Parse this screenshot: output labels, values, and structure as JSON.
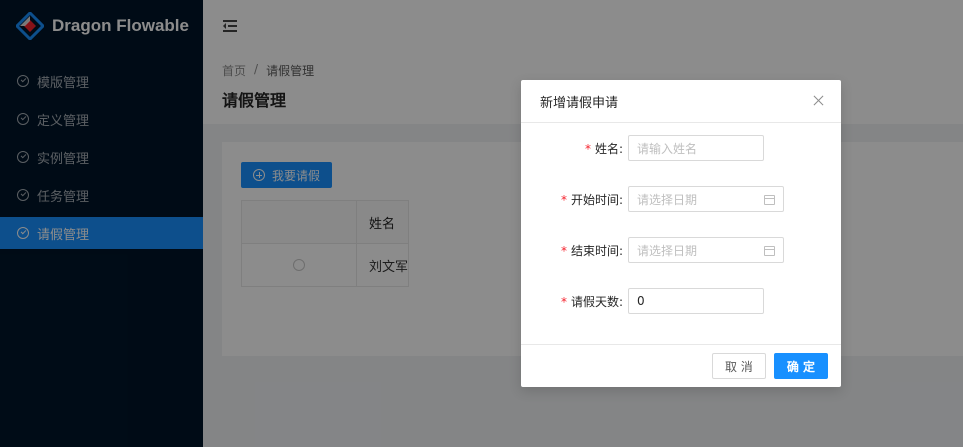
{
  "app": {
    "title": "Dragon Flowable"
  },
  "sidebar": {
    "items": [
      {
        "label": "模版管理"
      },
      {
        "label": "定义管理"
      },
      {
        "label": "实例管理"
      },
      {
        "label": "任务管理"
      },
      {
        "label": "请假管理",
        "active": true
      }
    ]
  },
  "breadcrumb": {
    "home": "首页",
    "separator": "/",
    "current": "请假管理"
  },
  "page": {
    "title": "请假管理"
  },
  "toolbar": {
    "add_label": "我要请假"
  },
  "table": {
    "columns": [
      "",
      "姓名"
    ],
    "rows": [
      {
        "name": "刘文军"
      }
    ]
  },
  "modal": {
    "title": "新增请假申请",
    "fields": {
      "name": {
        "label": "姓名:",
        "placeholder": "请输入姓名",
        "required": true
      },
      "start": {
        "label": "开始时间:",
        "placeholder": "请选择日期",
        "required": true
      },
      "end": {
        "label": "结束时间:",
        "placeholder": "请选择日期",
        "required": true
      },
      "days": {
        "label": "请假天数:",
        "value": "0",
        "required": true
      }
    },
    "cancel_label": "取 消",
    "ok_label": "确 定"
  },
  "colors": {
    "primary": "#1890ff",
    "sidebar_bg": "#001529",
    "required": "#f5222d"
  },
  "icons": {
    "logo": "dragon-logo-icon",
    "menu": "check-circle-icon",
    "fold": "menu-fold-icon",
    "add": "plus-circle-icon",
    "calendar": "calendar-icon",
    "close": "close-icon"
  }
}
